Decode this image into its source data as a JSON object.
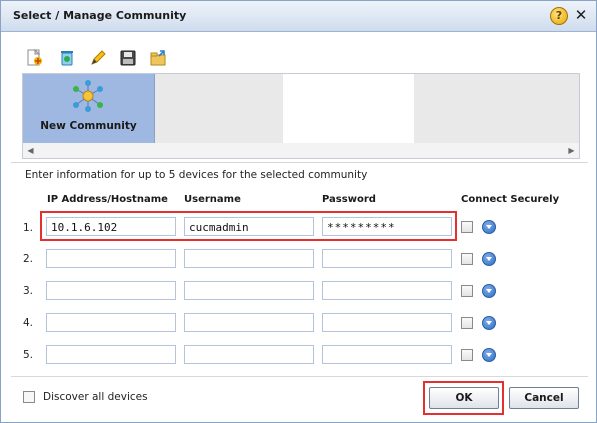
{
  "dialog": {
    "title": "Select / Manage Community",
    "help_glyph": "?",
    "close_glyph": "✕"
  },
  "toolbar": {
    "icons": [
      "new-icon",
      "delete-icon",
      "edit-icon",
      "save-icon",
      "import-icon"
    ]
  },
  "communities": [
    {
      "label": "New Community",
      "selected": true
    }
  ],
  "instructions": "Enter information for up to 5 devices for the selected community",
  "columns": {
    "ip": "IP Address/Hostname",
    "username": "Username",
    "password": "Password",
    "secure": "Connect Securely"
  },
  "rows": [
    {
      "num": "1.",
      "ip": "10.1.6.102",
      "username": "cucmadmin",
      "password": "*********",
      "secure": false
    },
    {
      "num": "2.",
      "ip": "",
      "username": "",
      "password": "",
      "secure": false
    },
    {
      "num": "3.",
      "ip": "",
      "username": "",
      "password": "",
      "secure": false
    },
    {
      "num": "4.",
      "ip": "",
      "username": "",
      "password": "",
      "secure": false
    },
    {
      "num": "5.",
      "ip": "",
      "username": "",
      "password": "",
      "secure": false
    }
  ],
  "footer": {
    "discover_label": "Discover all devices",
    "ok_label": "OK",
    "cancel_label": "Cancel"
  },
  "colors": {
    "title_bar": "#cfdcee",
    "selected_tile": "#9fb8e2",
    "highlight": "#e53030"
  }
}
